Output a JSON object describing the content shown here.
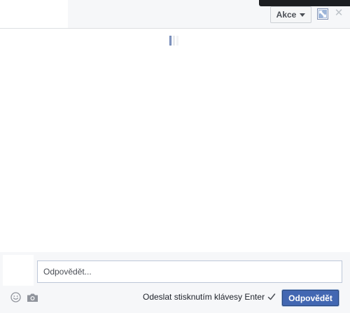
{
  "header": {
    "actions_label": "Akce",
    "actions_icon": "chevron-down-icon",
    "expand_icon": "expand-icon",
    "close_label": "✕"
  },
  "composer": {
    "reply_placeholder": "Odpovědět...",
    "enter_to_send_label": "Odeslat stisknutím klávesy Enter",
    "enter_to_send_checked": true,
    "submit_label": "Odpovědět",
    "icons": [
      "emoji-icon",
      "camera-icon"
    ]
  },
  "colors": {
    "brand_button": "#4267b2",
    "header_bg": "#f6f7f9",
    "tooltip_bg": "#1c1e21"
  }
}
